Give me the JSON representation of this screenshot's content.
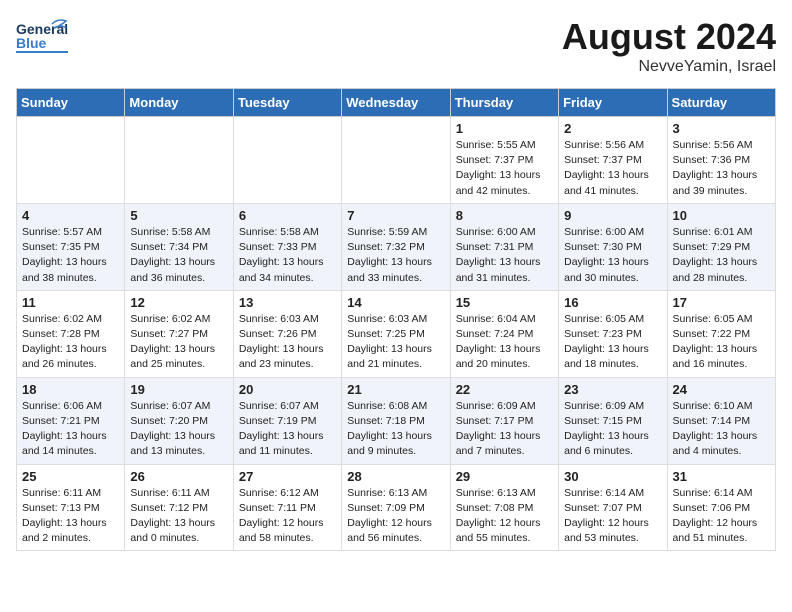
{
  "header": {
    "logo_general": "General",
    "logo_blue": "Blue",
    "month": "August 2024",
    "location": "NevveYamin, Israel"
  },
  "weekdays": [
    "Sunday",
    "Monday",
    "Tuesday",
    "Wednesday",
    "Thursday",
    "Friday",
    "Saturday"
  ],
  "weeks": [
    [
      {
        "day": "",
        "info": ""
      },
      {
        "day": "",
        "info": ""
      },
      {
        "day": "",
        "info": ""
      },
      {
        "day": "",
        "info": ""
      },
      {
        "day": "1",
        "info": "Sunrise: 5:55 AM\nSunset: 7:37 PM\nDaylight: 13 hours\nand 42 minutes."
      },
      {
        "day": "2",
        "info": "Sunrise: 5:56 AM\nSunset: 7:37 PM\nDaylight: 13 hours\nand 41 minutes."
      },
      {
        "day": "3",
        "info": "Sunrise: 5:56 AM\nSunset: 7:36 PM\nDaylight: 13 hours\nand 39 minutes."
      }
    ],
    [
      {
        "day": "4",
        "info": "Sunrise: 5:57 AM\nSunset: 7:35 PM\nDaylight: 13 hours\nand 38 minutes."
      },
      {
        "day": "5",
        "info": "Sunrise: 5:58 AM\nSunset: 7:34 PM\nDaylight: 13 hours\nand 36 minutes."
      },
      {
        "day": "6",
        "info": "Sunrise: 5:58 AM\nSunset: 7:33 PM\nDaylight: 13 hours\nand 34 minutes."
      },
      {
        "day": "7",
        "info": "Sunrise: 5:59 AM\nSunset: 7:32 PM\nDaylight: 13 hours\nand 33 minutes."
      },
      {
        "day": "8",
        "info": "Sunrise: 6:00 AM\nSunset: 7:31 PM\nDaylight: 13 hours\nand 31 minutes."
      },
      {
        "day": "9",
        "info": "Sunrise: 6:00 AM\nSunset: 7:30 PM\nDaylight: 13 hours\nand 30 minutes."
      },
      {
        "day": "10",
        "info": "Sunrise: 6:01 AM\nSunset: 7:29 PM\nDaylight: 13 hours\nand 28 minutes."
      }
    ],
    [
      {
        "day": "11",
        "info": "Sunrise: 6:02 AM\nSunset: 7:28 PM\nDaylight: 13 hours\nand 26 minutes."
      },
      {
        "day": "12",
        "info": "Sunrise: 6:02 AM\nSunset: 7:27 PM\nDaylight: 13 hours\nand 25 minutes."
      },
      {
        "day": "13",
        "info": "Sunrise: 6:03 AM\nSunset: 7:26 PM\nDaylight: 13 hours\nand 23 minutes."
      },
      {
        "day": "14",
        "info": "Sunrise: 6:03 AM\nSunset: 7:25 PM\nDaylight: 13 hours\nand 21 minutes."
      },
      {
        "day": "15",
        "info": "Sunrise: 6:04 AM\nSunset: 7:24 PM\nDaylight: 13 hours\nand 20 minutes."
      },
      {
        "day": "16",
        "info": "Sunrise: 6:05 AM\nSunset: 7:23 PM\nDaylight: 13 hours\nand 18 minutes."
      },
      {
        "day": "17",
        "info": "Sunrise: 6:05 AM\nSunset: 7:22 PM\nDaylight: 13 hours\nand 16 minutes."
      }
    ],
    [
      {
        "day": "18",
        "info": "Sunrise: 6:06 AM\nSunset: 7:21 PM\nDaylight: 13 hours\nand 14 minutes."
      },
      {
        "day": "19",
        "info": "Sunrise: 6:07 AM\nSunset: 7:20 PM\nDaylight: 13 hours\nand 13 minutes."
      },
      {
        "day": "20",
        "info": "Sunrise: 6:07 AM\nSunset: 7:19 PM\nDaylight: 13 hours\nand 11 minutes."
      },
      {
        "day": "21",
        "info": "Sunrise: 6:08 AM\nSunset: 7:18 PM\nDaylight: 13 hours\nand 9 minutes."
      },
      {
        "day": "22",
        "info": "Sunrise: 6:09 AM\nSunset: 7:17 PM\nDaylight: 13 hours\nand 7 minutes."
      },
      {
        "day": "23",
        "info": "Sunrise: 6:09 AM\nSunset: 7:15 PM\nDaylight: 13 hours\nand 6 minutes."
      },
      {
        "day": "24",
        "info": "Sunrise: 6:10 AM\nSunset: 7:14 PM\nDaylight: 13 hours\nand 4 minutes."
      }
    ],
    [
      {
        "day": "25",
        "info": "Sunrise: 6:11 AM\nSunset: 7:13 PM\nDaylight: 13 hours\nand 2 minutes."
      },
      {
        "day": "26",
        "info": "Sunrise: 6:11 AM\nSunset: 7:12 PM\nDaylight: 13 hours\nand 0 minutes."
      },
      {
        "day": "27",
        "info": "Sunrise: 6:12 AM\nSunset: 7:11 PM\nDaylight: 12 hours\nand 58 minutes."
      },
      {
        "day": "28",
        "info": "Sunrise: 6:13 AM\nSunset: 7:09 PM\nDaylight: 12 hours\nand 56 minutes."
      },
      {
        "day": "29",
        "info": "Sunrise: 6:13 AM\nSunset: 7:08 PM\nDaylight: 12 hours\nand 55 minutes."
      },
      {
        "day": "30",
        "info": "Sunrise: 6:14 AM\nSunset: 7:07 PM\nDaylight: 12 hours\nand 53 minutes."
      },
      {
        "day": "31",
        "info": "Sunrise: 6:14 AM\nSunset: 7:06 PM\nDaylight: 12 hours\nand 51 minutes."
      }
    ]
  ]
}
